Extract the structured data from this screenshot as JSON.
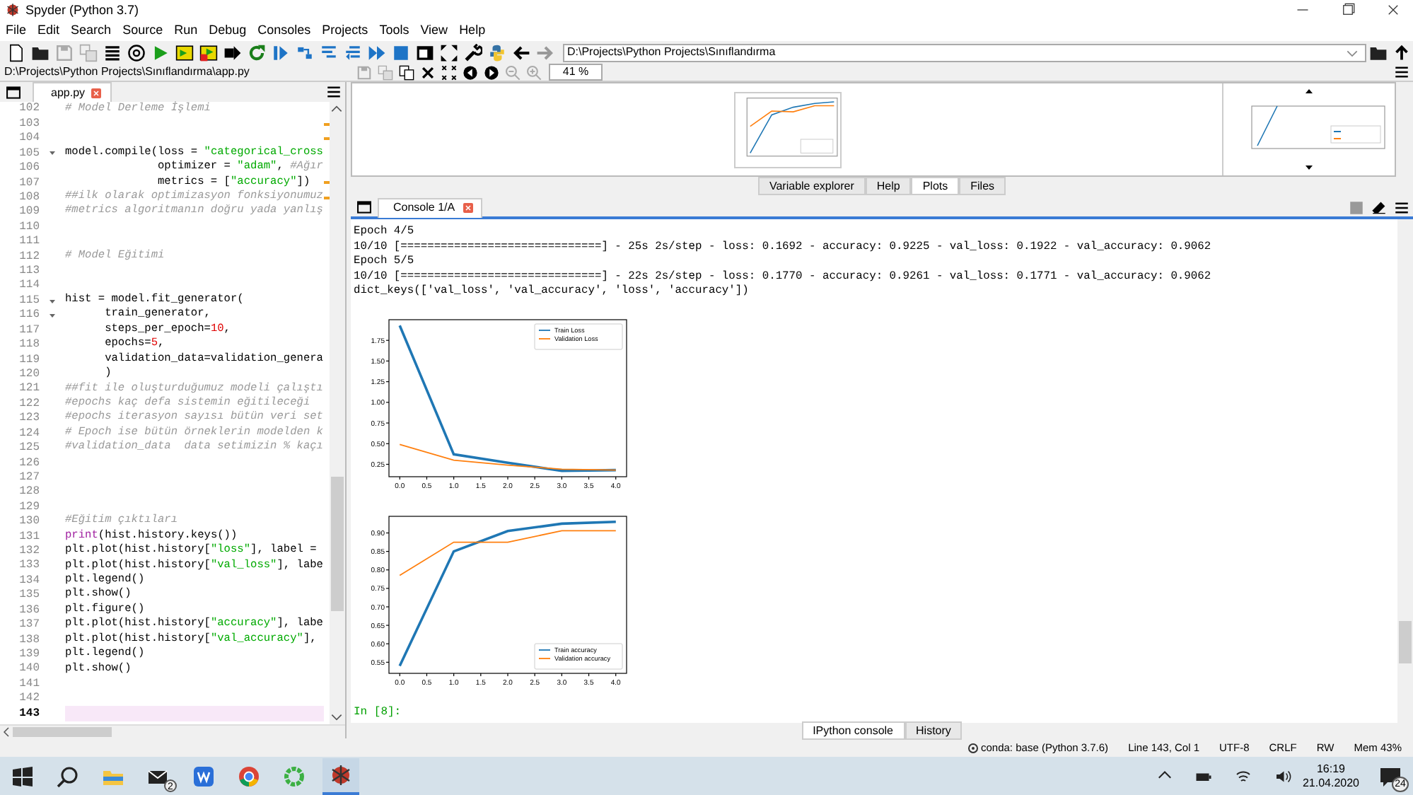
{
  "window": {
    "title": "Spyder (Python 3.7)"
  },
  "menu": [
    "File",
    "Edit",
    "Search",
    "Source",
    "Run",
    "Debug",
    "Consoles",
    "Projects",
    "Tools",
    "View",
    "Help"
  ],
  "toolbar": {
    "path": "D:\\Projects\\Python Projects\\Sınıflandırma"
  },
  "editor": {
    "file_path": "D:\\Projects\\Python Projects\\Sınıflandırma\\app.py",
    "tabs": [
      {
        "label": "app.py",
        "selected": true
      }
    ],
    "lines": [
      {
        "number": "102",
        "tokens": [
          {
            "kind": "comment",
            "text": "# Model Derleme İşlemi"
          }
        ],
        "foldable": false,
        "current": false,
        "flagged": false
      },
      {
        "number": "103",
        "foldable": false,
        "current": false,
        "flagged": true
      },
      {
        "number": "104",
        "foldable": false,
        "current": false,
        "flagged": true
      },
      {
        "number": "105",
        "tokens": [
          {
            "kind": "plain",
            "text": "model.compile(loss = "
          },
          {
            "kind": "string",
            "text": "\"categorical_cross"
          }
        ],
        "foldable": true,
        "current": false,
        "flagged": false
      },
      {
        "number": "106",
        "tokens": [
          {
            "kind": "plain",
            "text": "              optimizer = "
          },
          {
            "kind": "string",
            "text": "\"adam\""
          },
          {
            "kind": "plain",
            "text": ", "
          },
          {
            "kind": "comment",
            "text": "#Ağır"
          }
        ],
        "foldable": false,
        "current": false,
        "flagged": false
      },
      {
        "number": "107",
        "tokens": [
          {
            "kind": "plain",
            "text": "              metrics = ["
          },
          {
            "kind": "string",
            "text": "\"accuracy\""
          },
          {
            "kind": "plain",
            "text": "])"
          }
        ],
        "foldable": false,
        "current": false,
        "flagged": true
      },
      {
        "number": "108",
        "tokens": [
          {
            "kind": "comment",
            "text": "##ilk olarak optimizasyon fonksiyonumuz"
          }
        ],
        "foldable": false,
        "current": false,
        "flagged": true
      },
      {
        "number": "109",
        "tokens": [
          {
            "kind": "comment",
            "text": "#metrics algoritmanın doğru yada yanlış"
          }
        ],
        "foldable": false,
        "current": false,
        "flagged": false
      },
      {
        "number": "110",
        "foldable": false,
        "current": false,
        "flagged": false
      },
      {
        "number": "111",
        "foldable": false,
        "current": false,
        "flagged": false
      },
      {
        "number": "112",
        "tokens": [
          {
            "kind": "comment",
            "text": "# Model Eğitimi"
          }
        ],
        "foldable": false,
        "current": false,
        "flagged": false
      },
      {
        "number": "113",
        "foldable": false,
        "current": false,
        "flagged": false
      },
      {
        "number": "114",
        "foldable": false,
        "current": false,
        "flagged": false
      },
      {
        "number": "115",
        "tokens": [
          {
            "kind": "plain",
            "text": "hist = model.fit_generator("
          }
        ],
        "foldable": true,
        "current": false,
        "flagged": false
      },
      {
        "number": "116",
        "tokens": [
          {
            "kind": "plain",
            "text": "      train_generator,"
          }
        ],
        "foldable": true,
        "current": false,
        "flagged": false
      },
      {
        "number": "117",
        "tokens": [
          {
            "kind": "plain",
            "text": "      steps_per_epoch="
          },
          {
            "kind": "number",
            "text": "10"
          },
          {
            "kind": "plain",
            "text": ","
          }
        ],
        "foldable": false,
        "current": false,
        "flagged": false
      },
      {
        "number": "118",
        "tokens": [
          {
            "kind": "plain",
            "text": "      epochs="
          },
          {
            "kind": "number",
            "text": "5"
          },
          {
            "kind": "plain",
            "text": ","
          }
        ],
        "foldable": false,
        "current": false,
        "flagged": false
      },
      {
        "number": "119",
        "tokens": [
          {
            "kind": "plain",
            "text": "      validation_data=validation_genera"
          }
        ],
        "foldable": false,
        "current": false,
        "flagged": false
      },
      {
        "number": "120",
        "tokens": [
          {
            "kind": "plain",
            "text": "      )"
          }
        ],
        "foldable": false,
        "current": false,
        "flagged": false
      },
      {
        "number": "121",
        "tokens": [
          {
            "kind": "comment",
            "text": "##fit ile oluşturduğumuz modeli çalıştı"
          }
        ],
        "foldable": false,
        "current": false,
        "flagged": false
      },
      {
        "number": "122",
        "tokens": [
          {
            "kind": "comment",
            "text": "#epochs kaç defa sistemin eğitileceği"
          }
        ],
        "foldable": false,
        "current": false,
        "flagged": false
      },
      {
        "number": "123",
        "tokens": [
          {
            "kind": "comment",
            "text": "#epochs iterasyon sayısı bütün veri set"
          }
        ],
        "foldable": false,
        "current": false,
        "flagged": false
      },
      {
        "number": "124",
        "tokens": [
          {
            "kind": "comment",
            "text": "# Epoch ise bütün örneklerin modelden k"
          }
        ],
        "foldable": false,
        "current": false,
        "flagged": false
      },
      {
        "number": "125",
        "tokens": [
          {
            "kind": "comment",
            "text": "#validation_data  data setimizin % kaçı"
          }
        ],
        "foldable": false,
        "current": false,
        "flagged": false
      },
      {
        "number": "126",
        "foldable": false,
        "current": false,
        "flagged": false
      },
      {
        "number": "127",
        "foldable": false,
        "current": false,
        "flagged": false
      },
      {
        "number": "128",
        "foldable": false,
        "current": false,
        "flagged": false
      },
      {
        "number": "129",
        "foldable": false,
        "current": false,
        "flagged": false
      },
      {
        "number": "130",
        "tokens": [
          {
            "kind": "comment",
            "text": "#Eğitim çıktıları"
          }
        ],
        "foldable": false,
        "current": false,
        "flagged": false
      },
      {
        "number": "131",
        "tokens": [
          {
            "kind": "keyword",
            "text": "print"
          },
          {
            "kind": "plain",
            "text": "(hist.history.keys())"
          }
        ],
        "foldable": false,
        "current": false,
        "flagged": false
      },
      {
        "number": "132",
        "tokens": [
          {
            "kind": "plain",
            "text": "plt.plot(hist.history["
          },
          {
            "kind": "string",
            "text": "\"loss\""
          },
          {
            "kind": "plain",
            "text": "], label ="
          }
        ],
        "foldable": false,
        "current": false,
        "flagged": false
      },
      {
        "number": "133",
        "tokens": [
          {
            "kind": "plain",
            "text": "plt.plot(hist.history["
          },
          {
            "kind": "string",
            "text": "\"val_loss\""
          },
          {
            "kind": "plain",
            "text": "], labe"
          }
        ],
        "foldable": false,
        "current": false,
        "flagged": false
      },
      {
        "number": "134",
        "tokens": [
          {
            "kind": "plain",
            "text": "plt.legend()"
          }
        ],
        "foldable": false,
        "current": false,
        "flagged": false
      },
      {
        "number": "135",
        "tokens": [
          {
            "kind": "plain",
            "text": "plt.show()"
          }
        ],
        "foldable": false,
        "current": false,
        "flagged": false
      },
      {
        "number": "136",
        "tokens": [
          {
            "kind": "plain",
            "text": "plt.figure()"
          }
        ],
        "foldable": false,
        "current": false,
        "flagged": false
      },
      {
        "number": "137",
        "tokens": [
          {
            "kind": "plain",
            "text": "plt.plot(hist.history["
          },
          {
            "kind": "string",
            "text": "\"accuracy\""
          },
          {
            "kind": "plain",
            "text": "], labe"
          }
        ],
        "foldable": false,
        "current": false,
        "flagged": false
      },
      {
        "number": "138",
        "tokens": [
          {
            "kind": "plain",
            "text": "plt.plot(hist.history["
          },
          {
            "kind": "string",
            "text": "\"val_accuracy\""
          },
          {
            "kind": "plain",
            "text": "],"
          }
        ],
        "foldable": false,
        "current": false,
        "flagged": false
      },
      {
        "number": "139",
        "tokens": [
          {
            "kind": "plain",
            "text": "plt.legend()"
          }
        ],
        "foldable": false,
        "current": false,
        "flagged": false
      },
      {
        "number": "140",
        "tokens": [
          {
            "kind": "plain",
            "text": "plt.show()"
          }
        ],
        "foldable": false,
        "current": false,
        "flagged": false
      },
      {
        "number": "141",
        "foldable": false,
        "current": false,
        "flagged": false
      },
      {
        "number": "142",
        "foldable": false,
        "current": false,
        "flagged": false
      },
      {
        "number": "143",
        "foldable": false,
        "current": true,
        "flagged": false
      }
    ]
  },
  "plots": {
    "zoom": "41 %"
  },
  "pane_tabs": [
    {
      "label": "Variable explorer",
      "selected": false
    },
    {
      "label": "Help",
      "selected": false
    },
    {
      "label": "Plots",
      "selected": true
    },
    {
      "label": "Files",
      "selected": false
    }
  ],
  "console": {
    "tabs": [
      {
        "label": "Console 1/A",
        "selected": true
      }
    ],
    "output": [
      "Epoch 4/5",
      "10/10 [==============================] - 25s 2s/step - loss: 0.1692 - accuracy: 0.9225 - val_loss: 0.1922 - val_accuracy: 0.9062",
      "Epoch 5/5",
      "10/10 [==============================] - 22s 2s/step - loss: 0.1770 - accuracy: 0.9261 - val_loss: 0.1771 - val_accuracy: 0.9062",
      "dict_keys(['val_loss', 'val_accuracy', 'loss', 'accuracy'])"
    ],
    "figures": [
      {
        "chart_data": {
          "type": "line",
          "x": [
            0,
            1,
            2,
            3,
            4
          ],
          "series": [
            {
              "name": "Train Loss",
              "color": "#1f77b4",
              "values": [
                1.93,
                0.37,
                0.27,
                0.17,
                0.18
              ]
            },
            {
              "name": "Validation Loss",
              "color": "#ff7f0e",
              "values": [
                0.49,
                0.3,
                0.24,
                0.19,
                0.18
              ]
            }
          ],
          "xlim": [
            -0.2,
            4.2
          ],
          "ylim": [
            0.1,
            2.0
          ],
          "legend": "upper right",
          "xticks": [
            {
              "value": 0,
              "label": "0.0"
            },
            {
              "value": 0.5,
              "label": "0.5"
            },
            {
              "value": 1,
              "label": "1.0"
            },
            {
              "value": 1.5,
              "label": "1.5"
            },
            {
              "value": 2,
              "label": "2.0"
            },
            {
              "value": 2.5,
              "label": "2.5"
            },
            {
              "value": 3,
              "label": "3.0"
            },
            {
              "value": 3.5,
              "label": "3.5"
            },
            {
              "value": 4,
              "label": "4.0"
            }
          ],
          "yticks": [
            {
              "value": 0.25,
              "label": "0.25"
            },
            {
              "value": 0.5,
              "label": "0.50"
            },
            {
              "value": 0.75,
              "label": "0.75"
            },
            {
              "value": 1,
              "label": "1.00"
            },
            {
              "value": 1.25,
              "label": "1.25"
            },
            {
              "value": 1.5,
              "label": "1.50"
            },
            {
              "value": 1.75,
              "label": "1.75"
            }
          ]
        }
      },
      {
        "chart_data": {
          "type": "line",
          "x": [
            0,
            1,
            2,
            3,
            4
          ],
          "series": [
            {
              "name": "Train accuracy",
              "color": "#1f77b4",
              "values": [
                0.54,
                0.85,
                0.905,
                0.925,
                0.93
              ]
            },
            {
              "name": "Validation accuracy",
              "color": "#ff7f0e",
              "values": [
                0.785,
                0.875,
                0.875,
                0.906,
                0.906
              ]
            }
          ],
          "xlim": [
            -0.2,
            4.2
          ],
          "ylim": [
            0.52,
            0.945
          ],
          "legend": "lower right",
          "xticks": [
            {
              "value": 0,
              "label": "0.0"
            },
            {
              "value": 0.5,
              "label": "0.5"
            },
            {
              "value": 1,
              "label": "1.0"
            },
            {
              "value": 1.5,
              "label": "1.5"
            },
            {
              "value": 2,
              "label": "2.0"
            },
            {
              "value": 2.5,
              "label": "2.5"
            },
            {
              "value": 3,
              "label": "3.0"
            },
            {
              "value": 3.5,
              "label": "3.5"
            },
            {
              "value": 4,
              "label": "4.0"
            }
          ],
          "yticks": [
            {
              "value": 0.55,
              "label": "0.55"
            },
            {
              "value": 0.6,
              "label": "0.60"
            },
            {
              "value": 0.65,
              "label": "0.65"
            },
            {
              "value": 0.7,
              "label": "0.70"
            },
            {
              "value": 0.75,
              "label": "0.75"
            },
            {
              "value": 0.8,
              "label": "0.80"
            },
            {
              "value": 0.85,
              "label": "0.85"
            },
            {
              "value": 0.9,
              "label": "0.90"
            }
          ]
        }
      }
    ],
    "prompt": "In [8]:"
  },
  "bottom_tabs": [
    {
      "label": "IPython console",
      "selected": true
    },
    {
      "label": "History",
      "selected": false
    }
  ],
  "status_bar": {
    "environment": "conda: base (Python 3.7.6)",
    "items": [
      "Line 143, Col 1",
      "UTF-8",
      "CRLF",
      "RW",
      "Mem 43%"
    ]
  },
  "taskbar": {
    "mail_badge": "2",
    "time": "16:19",
    "date": "21.04.2020",
    "notifications": "24"
  }
}
